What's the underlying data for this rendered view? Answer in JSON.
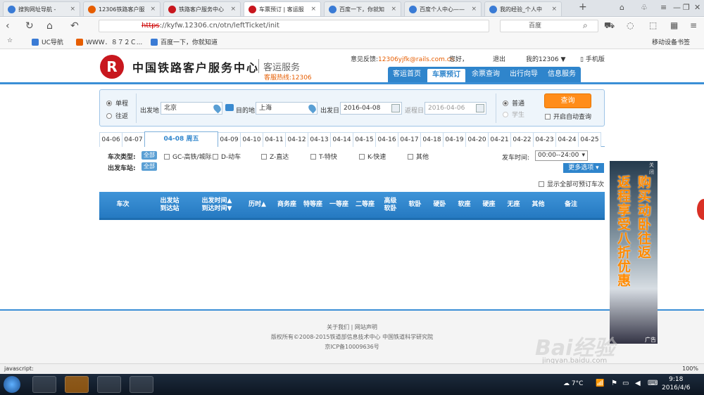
{
  "browser": {
    "tabs": [
      {
        "title": "搜狗网址导航 - ",
        "color": "#3a7bd5"
      },
      {
        "title": "12306铁路客户服",
        "color": "#e65d00"
      },
      {
        "title": "铁路客户服务中心",
        "color": "#c8171e"
      },
      {
        "title": "车票预订 | 客运服",
        "color": "#c8171e"
      },
      {
        "title": "百度一下，你就知",
        "color": "#3a7bd5"
      },
      {
        "title": "百度个人中心——",
        "color": "#3a7bd5"
      },
      {
        "title": "我的经验_个人中",
        "color": "#3a7bd5"
      }
    ],
    "url_scheme": "https",
    "url_rest": "://kyfw.12306.cn/otn/leftTicket/init",
    "search_engine": "百度",
    "bookmarks": [
      "UC导航",
      "WWW．８７２Ｃ...",
      "百度一下，你就知道"
    ],
    "mobile_bookmarks": "移动设备书签"
  },
  "site": {
    "logo_char": "R",
    "name": "中国铁路客户服务中心",
    "service": "客运服务",
    "hotline": "客服热线:12306",
    "feedback_label": "意见反馈:",
    "feedback_email": "12306yjfk@rails.com.cn",
    "hello": "您好，",
    "logout": "退出",
    "my12306": "我的12306 ▼",
    "mobile": "手机版",
    "nav": [
      "客运首页",
      "车票预订",
      "余票查询",
      "出行向导",
      "信息服务"
    ]
  },
  "query": {
    "oneway": "单程",
    "roundtrip": "往返",
    "from_label": "出发地",
    "from_value": "北京",
    "to_label": "目的地",
    "to_value": "上海",
    "date_label": "出发日",
    "date_value": "2016-04-08",
    "return_label": "返程日",
    "return_value": "2016-04-06",
    "normal": "普通",
    "student": "学生",
    "query_button": "查询",
    "auto_query": "开启自动查询"
  },
  "dates": [
    "04-06",
    "04-07",
    "04-08 周五",
    "04-09",
    "04-10",
    "04-11",
    "04-12",
    "04-13",
    "04-14",
    "04-15",
    "04-16",
    "04-17",
    "04-18",
    "04-19",
    "04-20",
    "04-21",
    "04-22",
    "04-23",
    "04-24",
    "04-25"
  ],
  "filters": {
    "train_type_label": "车次类型:",
    "station_label": "出发车站:",
    "all": "全部",
    "types": [
      "GC-高铁/城际",
      "D-动车",
      "Z-直达",
      "T-特快",
      "K-快速",
      "其他"
    ],
    "time_label": "发车时间:",
    "time_value": "00:00--24:00",
    "more": "更多选项",
    "show_all": "显示全部可预订车次"
  },
  "table_headers": [
    "车次",
    "出发站\n到达站",
    "出发时间▲\n到达时间▼",
    "历时▲",
    "商务座",
    "特等座",
    "一等座",
    "二等座",
    "高级\n软卧",
    "软卧",
    "硬卧",
    "软座",
    "硬座",
    "无座",
    "其他",
    "备注"
  ],
  "footer": {
    "links": "关于我们  |  网站声明",
    "copyright": "版权所有©2008-2015铁道部信息技术中心   中国铁道科学研究院",
    "icp": "京ICP备10009636号"
  },
  "ad": {
    "lines": [
      "购买动卧往返",
      "返程享受八折优惠"
    ],
    "close": "关闭",
    "label": "广告"
  },
  "watermark": {
    "main": "Bai经验",
    "sub": "jingyan.baidu.com"
  },
  "status": {
    "text": "javascript:",
    "zoom": "100%"
  },
  "taskbar": {
    "temp": "7°C",
    "time": "9:18",
    "date": "2016/4/6"
  }
}
